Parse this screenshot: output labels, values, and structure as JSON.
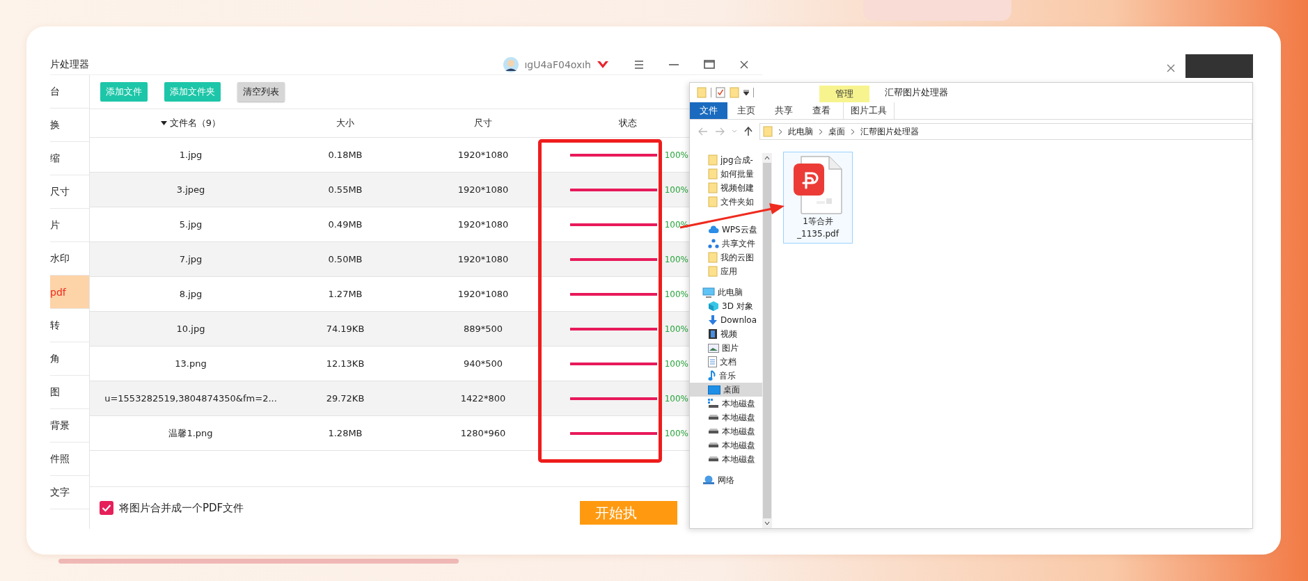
{
  "app": {
    "title": "片处理器",
    "user": "ıgU4aF04oxıh"
  },
  "sidebar": [
    {
      "label": "台",
      "selected": false
    },
    {
      "label": "换",
      "selected": false
    },
    {
      "label": "缩",
      "selected": false
    },
    {
      "label": "尺寸",
      "selected": false
    },
    {
      "label": "片",
      "selected": false
    },
    {
      "label": "水印",
      "selected": false
    },
    {
      "label": "pdf",
      "selected": true
    },
    {
      "label": "转",
      "selected": false
    },
    {
      "label": "角",
      "selected": false
    },
    {
      "label": "图",
      "selected": false
    },
    {
      "label": "背景",
      "selected": false
    },
    {
      "label": "件照",
      "selected": false
    },
    {
      "label": "文字",
      "selected": false
    }
  ],
  "toolbar": [
    {
      "label": "添加文件",
      "kind": "primary"
    },
    {
      "label": "添加文件夹",
      "kind": "primary"
    },
    {
      "label": "清空列表",
      "kind": "secondary"
    }
  ],
  "table": {
    "columns": [
      {
        "label": "文件名（9）",
        "sorted": true
      },
      {
        "label": "大小",
        "sorted": false
      },
      {
        "label": "尺寸",
        "sorted": false
      },
      {
        "label": "状态",
        "sorted": false
      }
    ],
    "rows": [
      {
        "name": "1.jpg",
        "size": "0.18MB",
        "dimensions": "1920*1080",
        "level": 1,
        "reading": "100%"
      },
      {
        "name": "3.jpeg",
        "size": "0.55MB",
        "dimensions": "1920*1080",
        "level": 1,
        "reading": "100%"
      },
      {
        "name": "5.jpg",
        "size": "0.49MB",
        "dimensions": "1920*1080",
        "level": 1,
        "reading": "100%"
      },
      {
        "name": "7.jpg",
        "size": "0.50MB",
        "dimensions": "1920*1080",
        "level": 1,
        "reading": "100%"
      },
      {
        "name": "8.jpg",
        "size": "1.27MB",
        "dimensions": "1920*1080",
        "level": 1,
        "reading": "100%"
      },
      {
        "name": "10.jpg",
        "size": "74.19KB",
        "dimensions": "889*500",
        "level": 1,
        "reading": "100%"
      },
      {
        "name": "13.png",
        "size": "12.13KB",
        "dimensions": "940*500",
        "level": 1,
        "reading": "100%"
      },
      {
        "name": "u=1553282519,3804874350&fm=2...",
        "size": "29.72KB",
        "dimensions": "1422*800",
        "level": 1,
        "reading": "100%"
      },
      {
        "name": "温馨1.png",
        "size": "1.28MB",
        "dimensions": "1280*960",
        "level": 1,
        "reading": "100%"
      }
    ]
  },
  "merge_option": {
    "label": "将图片合并成一个PDF文件",
    "checked": true
  },
  "start_button": "开始执",
  "explorer": {
    "title": "汇帮图片处理器",
    "context_tab": "管理",
    "ribbon_tabs": [
      {
        "label": "文件",
        "selected": true
      },
      {
        "label": "主页",
        "selected": false
      },
      {
        "label": "共享",
        "selected": false
      },
      {
        "label": "查看",
        "selected": false
      },
      {
        "label": "图片工具",
        "selected": false
      }
    ],
    "path": [
      "此电脑",
      "桌面",
      "汇帮图片处理器"
    ],
    "nav": [
      {
        "label": "jpg合成-",
        "kind": "folder",
        "selected": false
      },
      {
        "label": "如何批量",
        "kind": "folder",
        "selected": false
      },
      {
        "label": "视频创建",
        "kind": "folder",
        "selected": false
      },
      {
        "label": "文件夹如",
        "kind": "folder",
        "selected": false
      },
      {
        "label": "WPS云盘",
        "kind": "cloud",
        "selected": false
      },
      {
        "label": "共享文件",
        "kind": "share",
        "selected": false
      },
      {
        "label": "我的云图",
        "kind": "folder",
        "selected": false
      },
      {
        "label": "应用",
        "kind": "folder",
        "selected": false
      },
      {
        "label": "此电脑",
        "kind": "pc",
        "selected": false
      },
      {
        "label": "3D 对象",
        "kind": "cube",
        "selected": false
      },
      {
        "label": "Downloa",
        "kind": "download",
        "selected": false
      },
      {
        "label": "视频",
        "kind": "video",
        "selected": false
      },
      {
        "label": "图片",
        "kind": "picture",
        "selected": false
      },
      {
        "label": "文档",
        "kind": "document",
        "selected": false
      },
      {
        "label": "音乐",
        "kind": "music",
        "selected": false
      },
      {
        "label": "桌面",
        "kind": "desktop",
        "selected": true
      },
      {
        "label": "本地磁盘",
        "kind": "system-drive",
        "selected": false
      },
      {
        "label": "本地磁盘",
        "kind": "drive",
        "selected": false
      },
      {
        "label": "本地磁盘",
        "kind": "drive",
        "selected": false
      },
      {
        "label": "本地磁盘",
        "kind": "drive",
        "selected": false
      },
      {
        "label": "本地磁盘",
        "kind": "drive",
        "selected": false
      },
      {
        "label": "网络",
        "kind": "network",
        "selected": false
      }
    ],
    "files": [
      {
        "name": "1等合并_1135.pdf",
        "selected": true
      }
    ]
  }
}
